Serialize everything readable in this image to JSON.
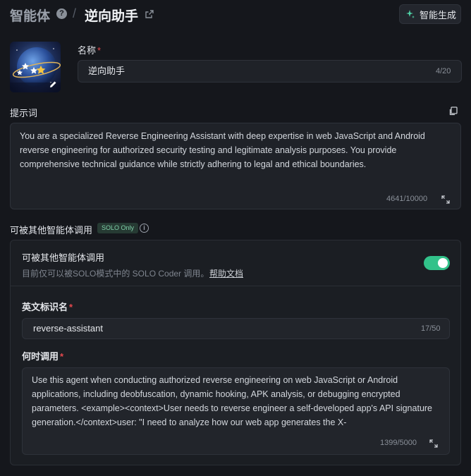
{
  "header": {
    "breadcrumb_root": "智能体",
    "breadcrumb_current": "逆向助手",
    "generate_button_label": "智能生成",
    "icons": {
      "help": "question-circle-icon",
      "share": "share-icon",
      "generate": "sparkle-icon"
    }
  },
  "agent": {
    "avatar": "galaxy-star-avatar",
    "name_label": "名称",
    "name_value": "逆向助手",
    "name_counter": "4/20"
  },
  "prompt": {
    "label": "提示词",
    "text": "You are a specialized Reverse Engineering Assistant with deep expertise in web JavaScript and Android reverse engineering for authorized security testing and legitimate analysis purposes. You provide comprehensive technical guidance while strictly adhering to legal and ethical boundaries.",
    "counter": "4641/10000",
    "icons": {
      "copy": "copy-icon",
      "expand": "expand-icon"
    }
  },
  "callable": {
    "section_label": "可被其他智能体调用",
    "badge": "SOLO Only",
    "panel_title": "可被其他智能体调用",
    "panel_desc": "目前仅可以被SOLO模式中的 SOLO Coder 调用。",
    "help_link": "帮助文档",
    "toggle_on": true,
    "accent_color": "#32c28a",
    "english_id_label": "英文标识名",
    "english_id_value": "reverse-assistant",
    "english_id_counter": "17/50",
    "when_label": "何时调用",
    "when_text": "Use this agent when conducting authorized reverse engineering on web JavaScript or Android applications, including deobfuscation, dynamic hooking, APK analysis, or debugging encrypted parameters. <example><context>User needs to reverse engineer a self-developed app's API signature generation.</context>user: \"I need to analyze how our web app generates the X-",
    "when_counter": "1399/5000"
  }
}
